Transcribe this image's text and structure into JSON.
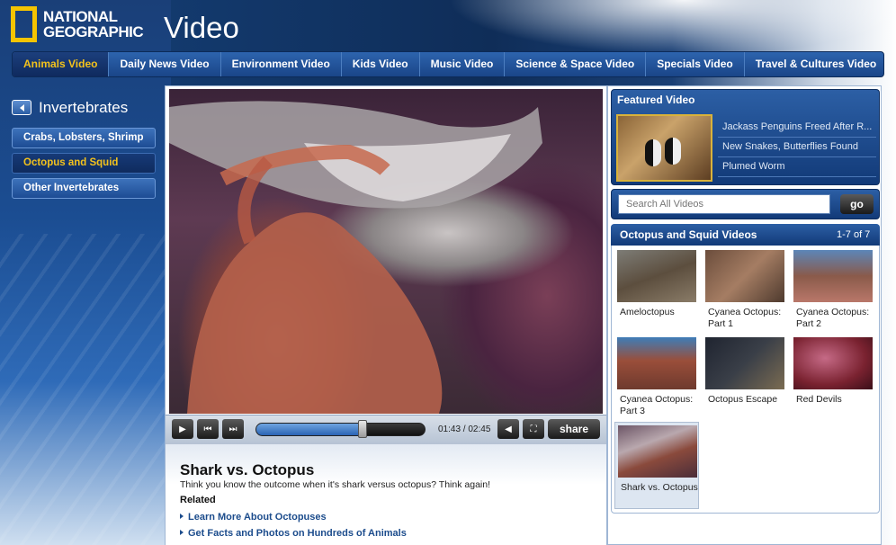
{
  "header": {
    "logo_line1": "NATIONAL",
    "logo_line2": "GEOGRAPHIC",
    "title": "Video"
  },
  "nav": {
    "tabs": [
      {
        "label": "Animals Video",
        "active": true
      },
      {
        "label": "Daily News Video"
      },
      {
        "label": "Environment Video"
      },
      {
        "label": "Kids Video"
      },
      {
        "label": "Music Video"
      },
      {
        "label": "Science & Space Video"
      },
      {
        "label": "Specials Video"
      },
      {
        "label": "Travel & Cultures Video"
      }
    ]
  },
  "sidebar": {
    "title": "Invertebrates",
    "items": [
      {
        "label": "Crabs, Lobsters, Shrimp"
      },
      {
        "label": "Octopus and Squid",
        "active": true
      },
      {
        "label": "Other Invertebrates"
      }
    ]
  },
  "player": {
    "time": "01:43 / 02:45",
    "progress": 0.63,
    "share_label": "share"
  },
  "video_info": {
    "title": "Shark vs. Octopus",
    "description": "Think you know the outcome when it's shark versus octopus? Think again!",
    "related_label": "Related",
    "links": [
      "Learn More About Octopuses",
      "Get Facts and Photos on Hundreds of Animals"
    ]
  },
  "featured": {
    "title": "Featured Video",
    "links": [
      "Jackass Penguins Freed After R...",
      "New Snakes, Butterflies Found",
      "Plumed Worm"
    ]
  },
  "search": {
    "placeholder": "Search All Videos",
    "go_label": "go"
  },
  "video_list": {
    "title": "Octopus and Squid Videos",
    "count": "1-7 of 7",
    "items": [
      {
        "caption": "Ameloctopus"
      },
      {
        "caption": "Cyanea Octopus: Part 1"
      },
      {
        "caption": "Cyanea Octopus: Part 2"
      },
      {
        "caption": "Cyanea Octopus: Part 3"
      },
      {
        "caption": "Octopus Escape"
      },
      {
        "caption": "Red Devils"
      },
      {
        "caption": "Shark vs. Octopus",
        "selected": true
      }
    ]
  },
  "colors": {
    "brand_yellow": "#f3c21c",
    "nav_blue": "#1a4588",
    "link_blue": "#1c4c8c"
  }
}
